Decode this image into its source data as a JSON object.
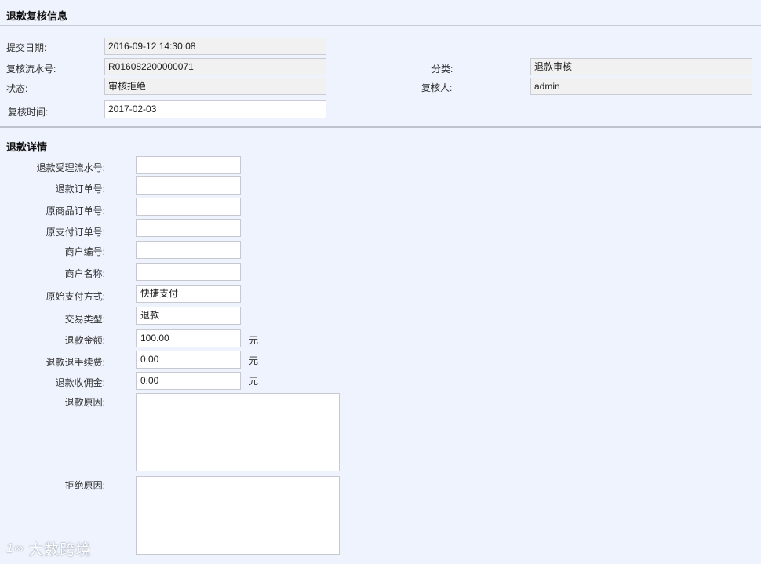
{
  "review": {
    "title": "退款复核信息",
    "submit_date_label": "提交日期:",
    "submit_date_value": "2016-09-12 14:30:08",
    "serial_label": "复核流水号:",
    "serial_value": "R016082200000071",
    "category_label": "分类:",
    "category_value": "退款审核",
    "status_label": "状态:",
    "status_value": "审核拒绝",
    "reviewer_label": "复核人:",
    "reviewer_value": "admin",
    "review_time_label": "复核时间:",
    "review_time_value": "2017-02-03"
  },
  "details": {
    "title": "退款详情",
    "fields": [
      {
        "label": "退款受理流水号:",
        "value": ""
      },
      {
        "label": "退款订单号:",
        "value": ""
      },
      {
        "label": "原商品订单号:",
        "value": ""
      },
      {
        "label": "原支付订单号:",
        "value": ""
      },
      {
        "label": "商户编号:",
        "value": ""
      },
      {
        "label": "商户名称:",
        "value": ""
      },
      {
        "label": "原始支付方式:",
        "value": "快捷支付"
      },
      {
        "label": "交易类型:",
        "value": "退款"
      },
      {
        "label": "退款金额:",
        "value": "100.00",
        "unit": "元"
      },
      {
        "label": "退款退手续费:",
        "value": "0.00",
        "unit": "元"
      },
      {
        "label": "退款收佣金:",
        "value": "0.00",
        "unit": "元"
      }
    ],
    "refund_reason_label": "退款原因:",
    "refund_reason_value": "",
    "reject_reason_label": "拒绝原因:",
    "reject_reason_value": ""
  },
  "watermark": {
    "text": "大数跨境",
    "logo_icon": "100-logo-icon"
  }
}
